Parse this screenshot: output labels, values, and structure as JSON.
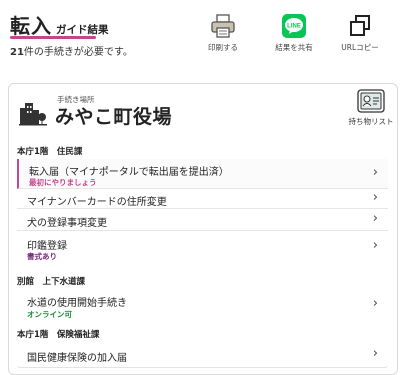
{
  "header": {
    "title": "転入",
    "title_sub": "ガイド結果",
    "subtitle_count": "21",
    "subtitle_rest": "件の手続きが必要です。",
    "accent_color": "#c5458f",
    "actions": [
      {
        "label": "印刷する",
        "icon": "printer-icon"
      },
      {
        "label": "結果を共有",
        "icon": "line-icon",
        "color": "#06c755"
      },
      {
        "label": "URLコピー",
        "icon": "copy-icon"
      }
    ]
  },
  "place": {
    "caption": "手続き場所",
    "name": "みやこ町役場",
    "belongings_label": "持ち物リスト"
  },
  "sections": [
    {
      "heading": "本庁1階　住民課",
      "items": [
        {
          "label": "転入届（マイナポータルで転出届を提出済）",
          "note": "最初にやりましょう",
          "note_color": "#c5458f"
        },
        {
          "label": "マイナンバーカードの住所変更",
          "note": ""
        },
        {
          "label": "犬の登録事項変更",
          "note": ""
        },
        {
          "label": "印鑑登録",
          "note": "書式あり",
          "note_color": "#7a2a7a"
        }
      ]
    },
    {
      "heading": "別館　上下水道課",
      "items": [
        {
          "label": "水道の使用開始手続き",
          "note": "オンライン可",
          "note_color": "#1d8a3a"
        }
      ]
    },
    {
      "heading": "本庁1階　保険福祉課",
      "items": [
        {
          "label": "国民健康保険の加入届",
          "note": ""
        }
      ]
    }
  ]
}
